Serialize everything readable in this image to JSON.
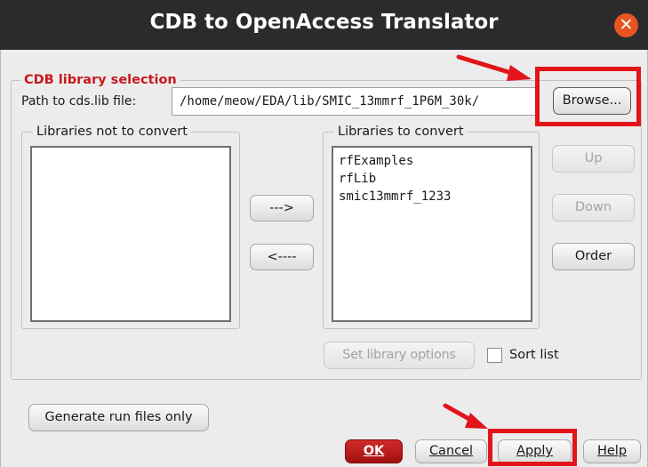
{
  "window": {
    "title": "CDB to OpenAccess Translator"
  },
  "library_selection": {
    "legend": "CDB library selection",
    "path_label": "Path to cds.lib file:",
    "path_value": "/home/meow/EDA/lib/SMIC_13mmrf_1P6M_30k/",
    "browse_label": "Browse..."
  },
  "libraries_not_to_convert": {
    "legend": "Libraries not to convert",
    "items": []
  },
  "libraries_to_convert": {
    "legend": "Libraries to convert",
    "items": [
      "rfExamples",
      "rfLib",
      "smic13mmrf_1233"
    ]
  },
  "buttons": {
    "move_right": "--->",
    "move_left": "<----",
    "up": "Up",
    "down": "Down",
    "order": "Order",
    "set_library_options": "Set library options",
    "sort_list": "Sort list",
    "generate_run_files": "Generate run files only",
    "ok": "OK",
    "cancel": "Cancel",
    "apply": "Apply",
    "help": "Help"
  },
  "colors": {
    "title_bg": "#2b2b2b",
    "close": "#e95420",
    "ok": "#b51818",
    "annotation": "#e3151a",
    "legend_red": "#c8181e"
  }
}
